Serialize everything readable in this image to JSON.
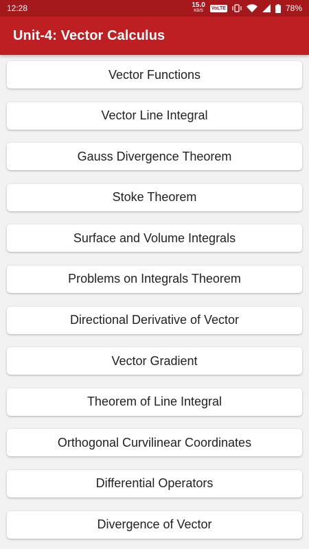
{
  "status_bar": {
    "time": "12:28",
    "network_speed": "15.0",
    "network_speed_unit": "KB/S",
    "volte_badge": "VoLTE",
    "battery": "78%"
  },
  "app_bar": {
    "title": "Unit-4: Vector Calculus"
  },
  "topics": [
    {
      "label": "Vector Functions"
    },
    {
      "label": "Vector Line Integral"
    },
    {
      "label": "Gauss Divergence Theorem"
    },
    {
      "label": "Stoke Theorem"
    },
    {
      "label": "Surface and Volume Integrals"
    },
    {
      "label": "Problems on Integrals Theorem"
    },
    {
      "label": "Directional Derivative of Vector"
    },
    {
      "label": "Vector Gradient"
    },
    {
      "label": "Theorem of Line Integral"
    },
    {
      "label": "Orthogonal Curvilinear Coordinates"
    },
    {
      "label": "Differential Operators"
    },
    {
      "label": "Divergence of Vector"
    }
  ],
  "colors": {
    "status_bar": "#a5181c",
    "app_bar": "#bd1f23",
    "background": "#f2f2f2",
    "card": "#ffffff",
    "text": "#212121"
  }
}
